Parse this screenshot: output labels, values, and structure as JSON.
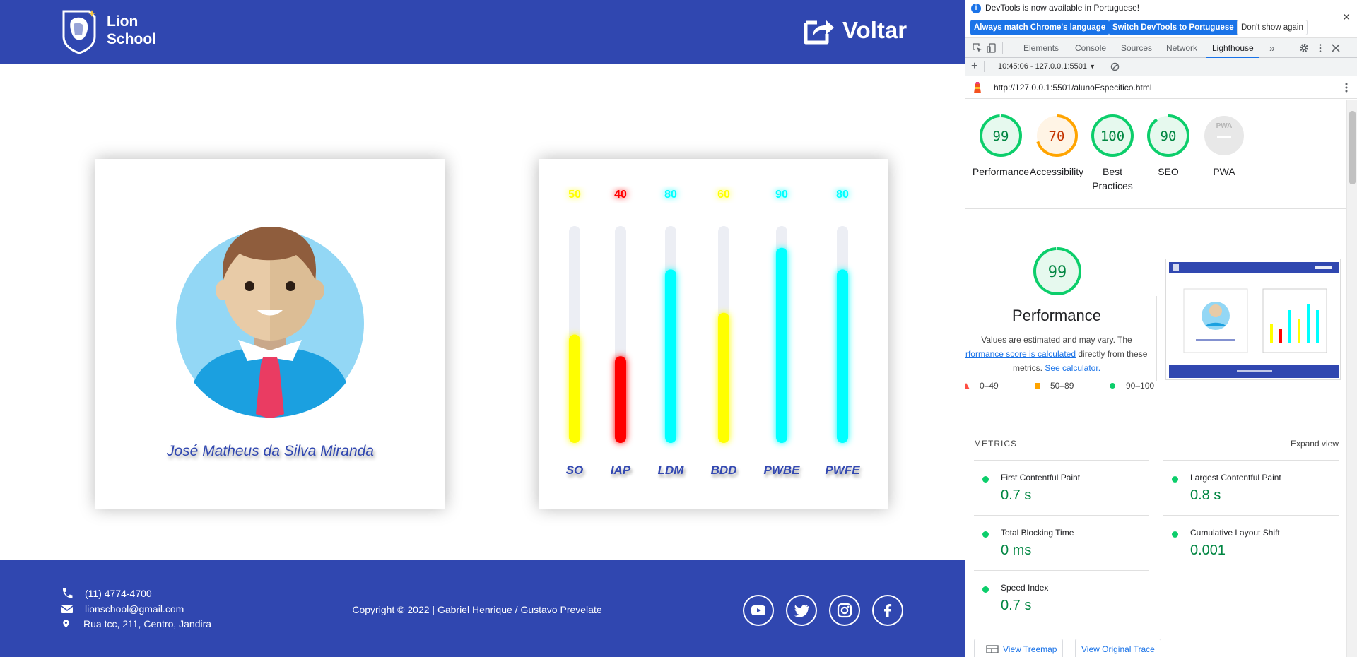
{
  "site": {
    "brand_line1": "Lion",
    "brand_line2": "School",
    "back_label": "Voltar",
    "student_name": "José Matheus da Silva Miranda",
    "footer": {
      "phone": "(11) 4774-4700",
      "email": "lionschool@gmail.com",
      "address": "Rua tcc, 211, Centro, Jandira",
      "copyright": "Copyright © 2022 | Gabriel Henrique / Gustavo Prevelate",
      "social": [
        "youtube-icon",
        "twitter-icon",
        "instagram-icon",
        "facebook-icon"
      ]
    }
  },
  "chart_data": {
    "type": "bar",
    "categories": [
      "SO",
      "IAP",
      "LDM",
      "BDD",
      "PWBE",
      "PWFE"
    ],
    "values": [
      50,
      40,
      80,
      60,
      90,
      80
    ],
    "ylim": [
      0,
      100
    ],
    "colors": [
      "#ffff00",
      "#ff0000",
      "#00ffff",
      "#ffff00",
      "#00ffff",
      "#00ffff"
    ],
    "label_color": "#3047b0",
    "track_color": "#eceef4"
  },
  "devtools": {
    "info_text": "DevTools is now available in Portuguese!",
    "btn_match": "Always match Chrome's language",
    "btn_switch": "Switch DevTools to Portuguese",
    "btn_dismiss": "Don't show again",
    "tabs": [
      "Elements",
      "Console",
      "Sources",
      "Network",
      "Lighthouse"
    ],
    "report_select": "10:45:06 - 127.0.0.1:5501",
    "url": "http://127.0.0.1:5501/alunoEspecifico.html",
    "gauges": [
      {
        "score": "99",
        "label": "Performance",
        "value": 99,
        "color": "#0cce6b",
        "fill": "#e6f9ee",
        "text": "#018642"
      },
      {
        "score": "70",
        "label": "Accessibility",
        "value": 70,
        "color": "#ffa400",
        "fill": "#fff4e5",
        "text": "#c33300"
      },
      {
        "score": "100",
        "label": "Best Practices",
        "value": 100,
        "color": "#0cce6b",
        "fill": "#e6f9ee",
        "text": "#018642"
      },
      {
        "score": "90",
        "label": "SEO",
        "value": 90,
        "color": "#0cce6b",
        "fill": "#e6f9ee",
        "text": "#018642"
      },
      {
        "score": "PWA",
        "label": "PWA",
        "value": 0,
        "color": "#d6d6d6",
        "fill": "#e8e8e8",
        "text": "#9e9e9e"
      }
    ],
    "perf_score": "99",
    "perf_title": "Performance",
    "perf_desc_1": "Values are estimated and may vary. The",
    "perf_desc_link": "performance score is calculated",
    "perf_desc_2": "directly from these",
    "perf_desc_3": "metrics.",
    "perf_desc_link2": "See calculator.",
    "legend": [
      "0–49",
      "50–89",
      "90–100"
    ],
    "metrics_title": "METRICS",
    "expand_view": "Expand view",
    "metrics": [
      {
        "name": "First Contentful Paint",
        "value": "0.7 s"
      },
      {
        "name": "Largest Contentful Paint",
        "value": "0.8 s"
      },
      {
        "name": "Total Blocking Time",
        "value": "0 ms"
      },
      {
        "name": "Cumulative Layout Shift",
        "value": "0.001"
      },
      {
        "name": "Speed Index",
        "value": "0.7 s"
      }
    ],
    "btn_treemap": "View Treemap",
    "btn_trace": "View Original Trace"
  }
}
